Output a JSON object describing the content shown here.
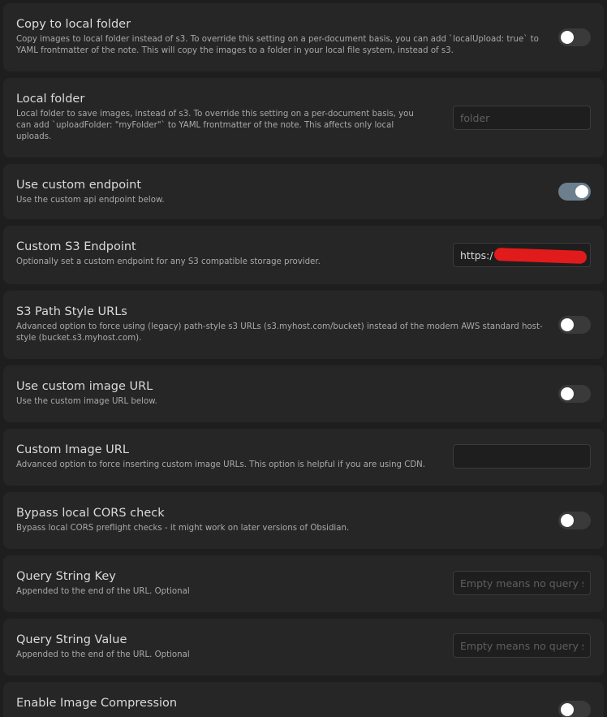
{
  "settings": [
    {
      "title": "Copy to local folder",
      "desc": "Copy images to local folder instead of s3. To override this setting on a per-document basis, you can add `localUpload: true` to YAML frontmatter of the note. This will copy the images to a folder in your local file system, instead of s3.",
      "control": "toggle",
      "value": false
    },
    {
      "title": "Local folder",
      "desc": "Local folder to save images, instead of s3. To override this setting on a per-document basis, you can add `uploadFolder: \"myFolder\"` to YAML frontmatter of the note. This affects only local uploads.",
      "control": "text",
      "value": "",
      "placeholder": "folder"
    },
    {
      "title": "Use custom endpoint",
      "desc": "Use the custom api endpoint below.",
      "control": "toggle",
      "value": true
    },
    {
      "title": "Custom S3 Endpoint",
      "desc": "Optionally set a custom endpoint for any S3 compatible storage provider.",
      "control": "text",
      "value": "https:/",
      "placeholder": "",
      "redacted": true
    },
    {
      "title": "S3 Path Style URLs",
      "desc": "Advanced option to force using (legacy) path-style s3 URLs (s3.myhost.com/bucket) instead of the modern AWS standard host-style (bucket.s3.myhost.com).",
      "control": "toggle",
      "value": false
    },
    {
      "title": "Use custom image URL",
      "desc": "Use the custom image URL below.",
      "control": "toggle",
      "value": false
    },
    {
      "title": "Custom Image URL",
      "desc": "Advanced option to force inserting custom image URLs. This option is helpful if you are using CDN.",
      "control": "text",
      "value": "",
      "placeholder": ""
    },
    {
      "title": "Bypass local CORS check",
      "desc": "Bypass local CORS preflight checks - it might work on later versions of Obsidian.",
      "control": "toggle",
      "value": false
    },
    {
      "title": "Query String Key",
      "desc": "Appended to the end of the URL. Optional",
      "control": "text",
      "value": "",
      "placeholder": "Empty means no query string"
    },
    {
      "title": "Query String Value",
      "desc": "Appended to the end of the URL. Optional",
      "control": "text",
      "value": "",
      "placeholder": "Empty means no query string"
    },
    {
      "title": "Enable Image Compression",
      "desc": "",
      "control": "toggle",
      "value": false
    }
  ],
  "colors": {
    "background": "#1e1e1e",
    "card": "#262626",
    "toggle_on": "#6b7f8e",
    "toggle_off": "#3a3a3a",
    "redaction": "#e11b1b"
  }
}
